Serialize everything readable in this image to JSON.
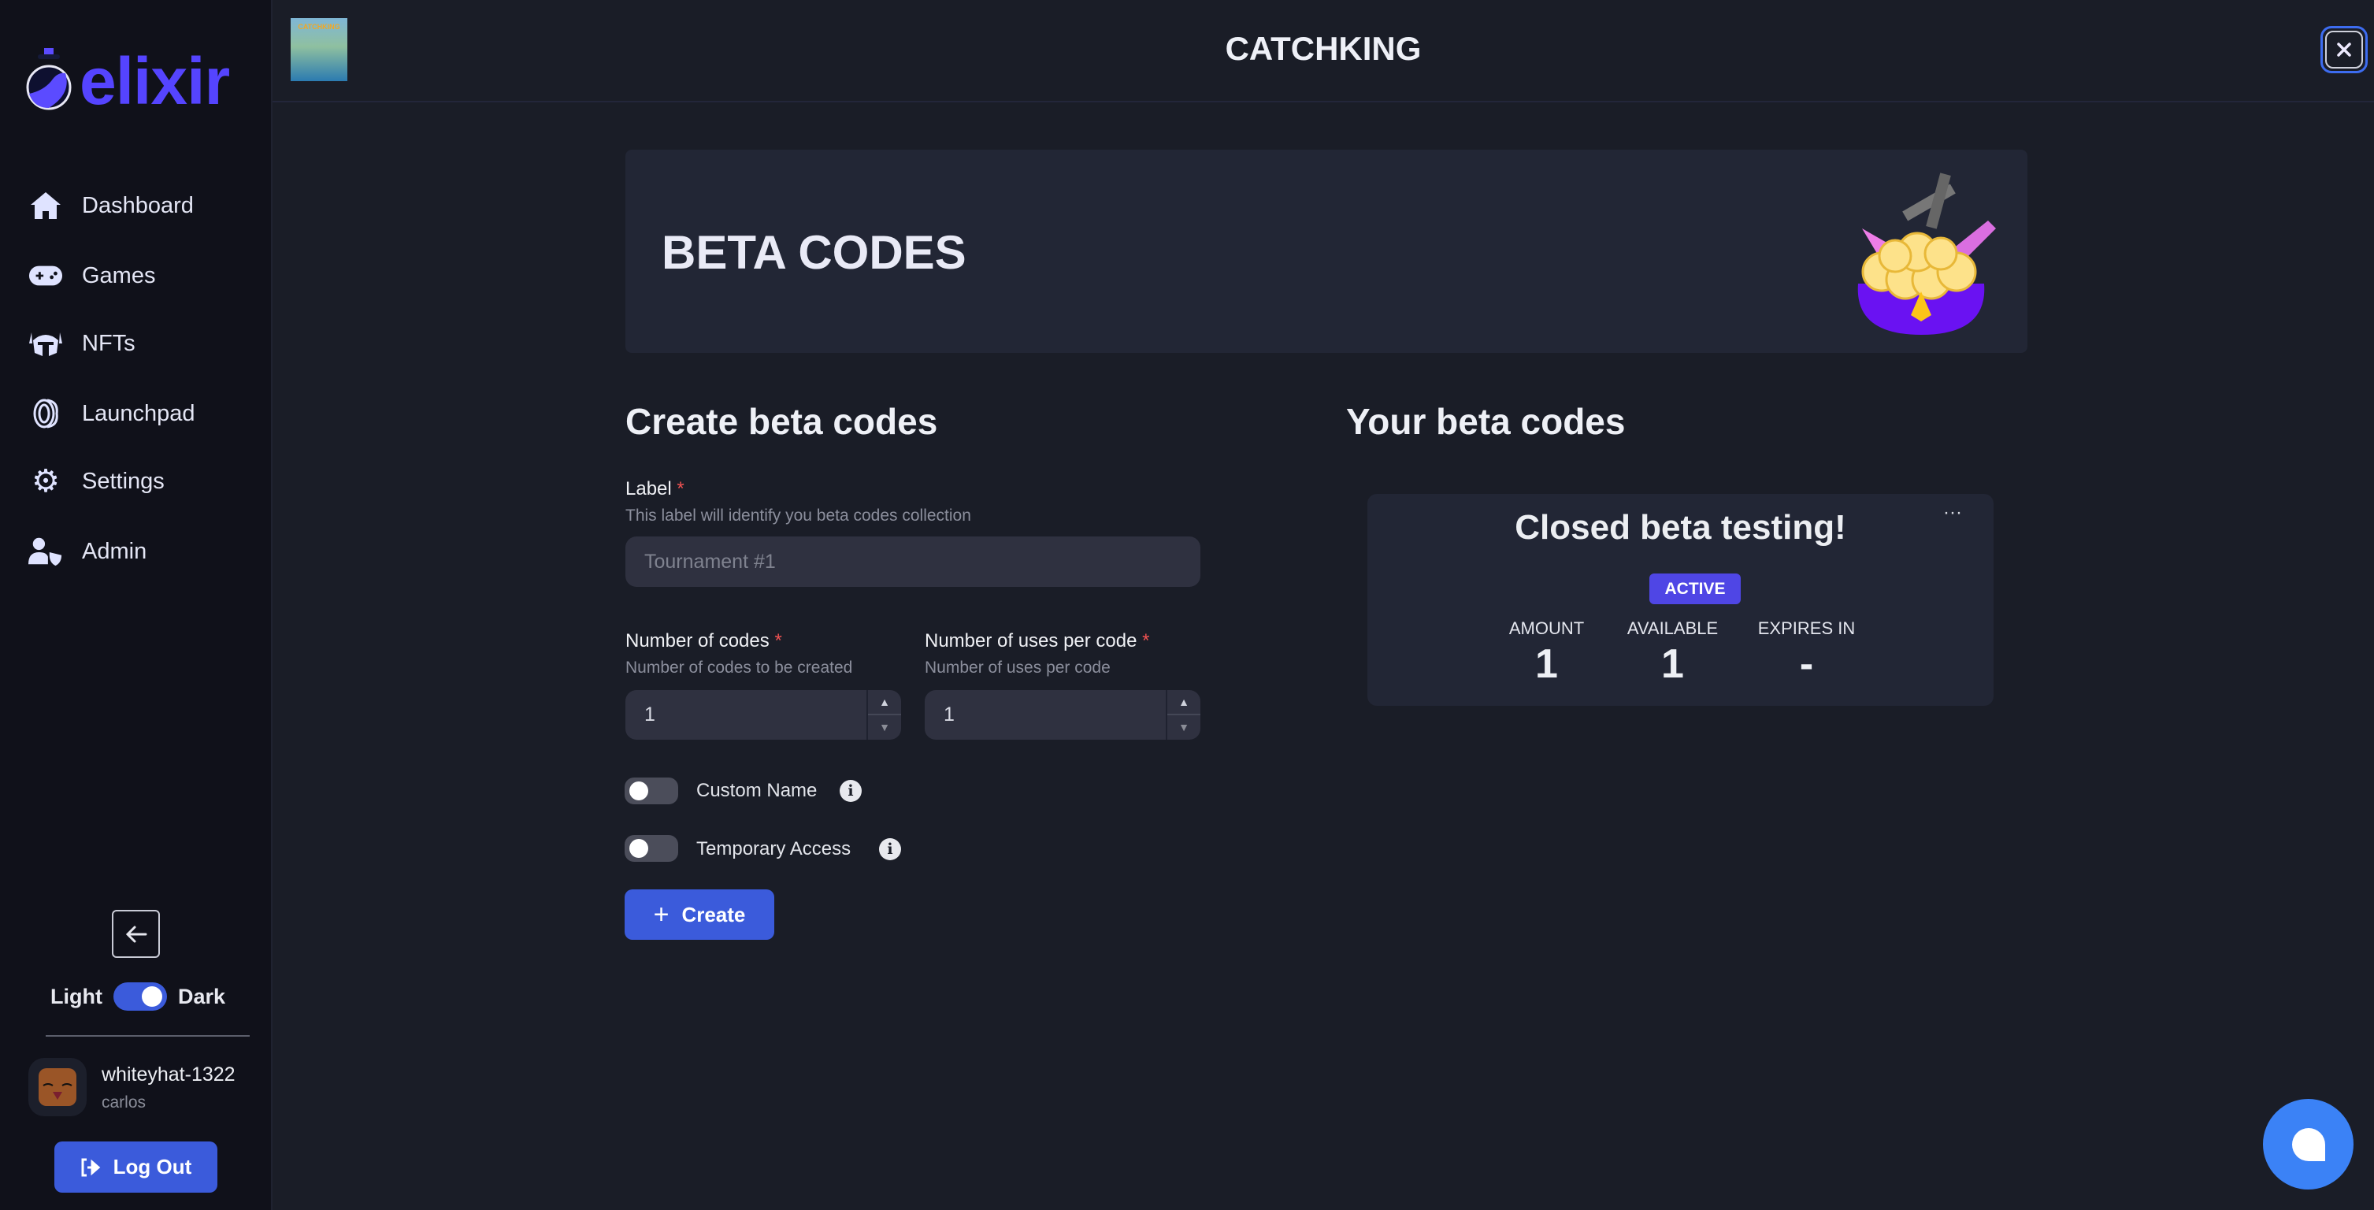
{
  "app": {
    "logo_text": "elixir",
    "game_title": "CATCHKING",
    "game_thumb_text": "CATCHKING"
  },
  "sidebar": {
    "items": [
      {
        "label": "Dashboard",
        "icon": "home-icon"
      },
      {
        "label": "Games",
        "icon": "gamepad-icon"
      },
      {
        "label": "NFTs",
        "icon": "helmet-icon"
      },
      {
        "label": "Launchpad",
        "icon": "coin-icon"
      },
      {
        "label": "Settings",
        "icon": "gear-icon"
      },
      {
        "label": "Admin",
        "icon": "user-shield-icon"
      }
    ],
    "theme": {
      "light": "Light",
      "dark": "Dark",
      "dark_enabled": true
    },
    "user": {
      "name": "whiteyhat-1322",
      "handle": "carlos"
    },
    "logout": "Log Out"
  },
  "banner": {
    "title": "BETA CODES"
  },
  "form": {
    "heading": "Create beta codes",
    "label": {
      "title": "Label",
      "required": "*",
      "help": "This label will identify you beta codes collection",
      "placeholder": "Tournament #1",
      "value": ""
    },
    "num_codes": {
      "title": "Number of codes",
      "required": "*",
      "help": "Number of codes to be created",
      "value": "1"
    },
    "uses_per_code": {
      "title": "Number of uses per code",
      "required": "*",
      "help": "Number of uses per code",
      "value": "1"
    },
    "custom_name": {
      "label": "Custom Name",
      "enabled": false
    },
    "temporary_access": {
      "label": "Temporary Access",
      "enabled": false
    },
    "create": "Create"
  },
  "codes": {
    "heading": "Your beta codes",
    "items": [
      {
        "title": "Closed beta testing!",
        "status": "ACTIVE",
        "more": "···",
        "stats": [
          {
            "label": "AMOUNT",
            "value": "1"
          },
          {
            "label": "AVAILABLE",
            "value": "1"
          },
          {
            "label": "EXPIRES IN",
            "value": "-"
          }
        ]
      }
    ]
  },
  "colors": {
    "accent": "#3b5bdb",
    "badge": "#4f46e5",
    "chat": "#3b82f6"
  }
}
